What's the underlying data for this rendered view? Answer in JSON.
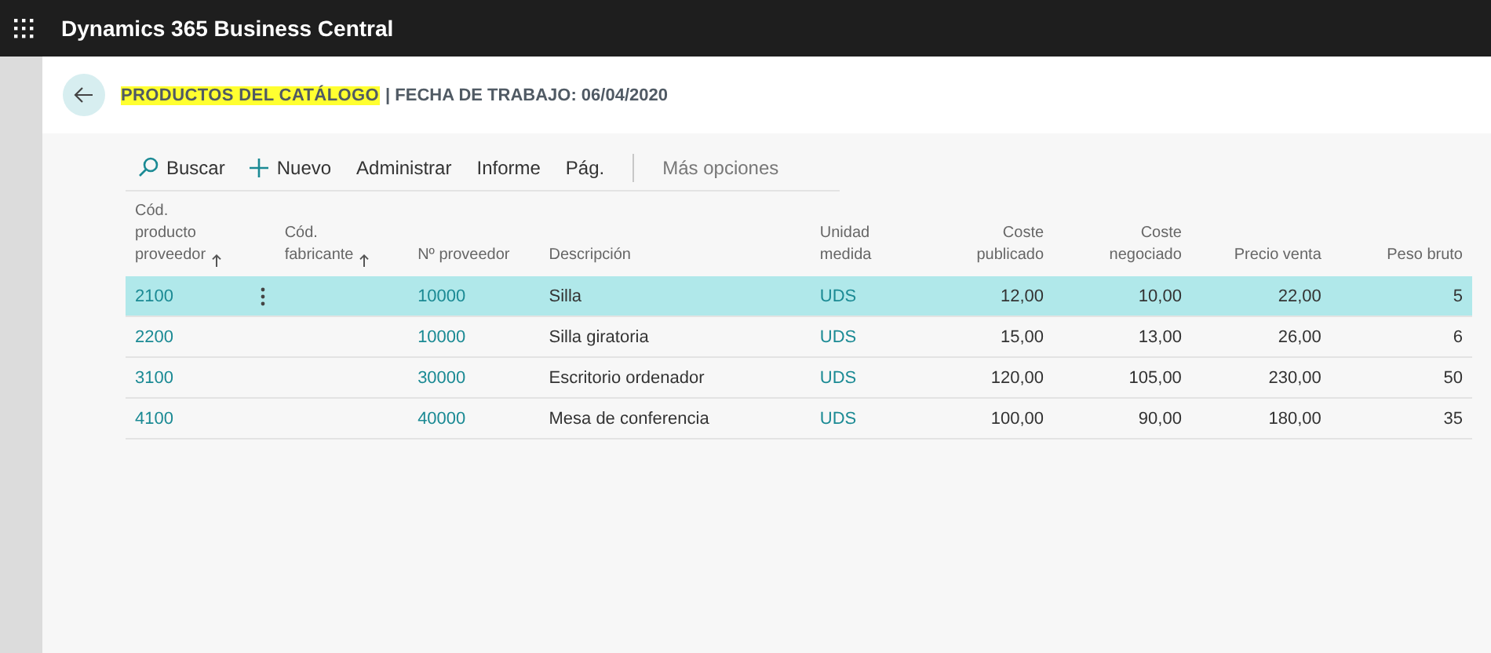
{
  "app_bar": {
    "title": "Dynamics 365 Business Central"
  },
  "page": {
    "title": "PRODUCTOS DEL CATÁLOGO",
    "title_highlighted": true,
    "subtitle": "| FECHA DE TRABAJO: 06/04/2020"
  },
  "actions": [
    {
      "label": "Buscar",
      "kind": "search"
    },
    {
      "label": "Nuevo",
      "kind": "new"
    },
    {
      "label": "Administrar",
      "kind": "plain"
    },
    {
      "label": "Informe",
      "kind": "plain"
    },
    {
      "label": "Pág.",
      "kind": "plain"
    },
    {
      "label": "Más opciones",
      "kind": "more"
    }
  ],
  "table": {
    "columns": [
      {
        "label": "Cód.\nproducto\nproveedor",
        "sorted": true,
        "kind": "link"
      },
      {
        "label": "Cód.\nfabricante",
        "sorted": true,
        "kind": "text"
      },
      {
        "label": "Nº proveedor",
        "sorted": false,
        "kind": "link"
      },
      {
        "label": "Descripción",
        "sorted": false,
        "kind": "text"
      },
      {
        "label": "Unidad\nmedida",
        "sorted": false,
        "kind": "link"
      },
      {
        "label": "Coste\npublicado",
        "sorted": false,
        "kind": "number"
      },
      {
        "label": "Coste\nnegociado",
        "sorted": false,
        "kind": "number"
      },
      {
        "label": "Precio venta",
        "sorted": false,
        "kind": "number"
      },
      {
        "label": "Peso bruto",
        "sorted": false,
        "kind": "number"
      }
    ],
    "rows": [
      {
        "selected": true,
        "cells": [
          "2100",
          "",
          "10000",
          "Silla",
          "UDS",
          "12,00",
          "10,00",
          "22,00",
          "5"
        ]
      },
      {
        "selected": false,
        "cells": [
          "2200",
          "",
          "10000",
          "Silla giratoria",
          "UDS",
          "15,00",
          "13,00",
          "26,00",
          "6"
        ]
      },
      {
        "selected": false,
        "cells": [
          "3100",
          "",
          "30000",
          "Escritorio ordenador",
          "UDS",
          "120,00",
          "105,00",
          "230,00",
          "50"
        ]
      },
      {
        "selected": false,
        "cells": [
          "4100",
          "",
          "40000",
          "Mesa de conferencia",
          "UDS",
          "100,00",
          "90,00",
          "180,00",
          "35"
        ]
      }
    ]
  }
}
